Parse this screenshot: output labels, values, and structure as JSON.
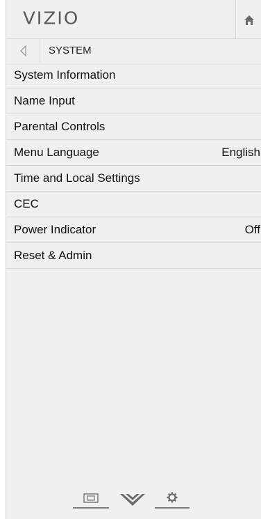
{
  "brand": {
    "logo_text": "VIZIO"
  },
  "header": {
    "home_icon": "home-icon"
  },
  "breadcrumb": {
    "back_icon": "back-arrow-icon",
    "title": "SYSTEM"
  },
  "menu": {
    "items": [
      {
        "label": "System Information",
        "value": ""
      },
      {
        "label": "Name Input",
        "value": ""
      },
      {
        "label": "Parental Controls",
        "value": ""
      },
      {
        "label": "Menu Language",
        "value": "English"
      },
      {
        "label": "Time and Local Settings",
        "value": ""
      },
      {
        "label": "CEC",
        "value": ""
      },
      {
        "label": "Power Indicator",
        "value": "Off"
      },
      {
        "label": "Reset & Admin",
        "value": ""
      }
    ]
  },
  "footer": {
    "icons": [
      "input-icon",
      "v-icon",
      "settings-gear-icon"
    ]
  },
  "colors": {
    "panel_bg": "#f0f0f0",
    "divider": "#d4d4d4",
    "text": "#111111",
    "icon": "#6a6a6a"
  }
}
